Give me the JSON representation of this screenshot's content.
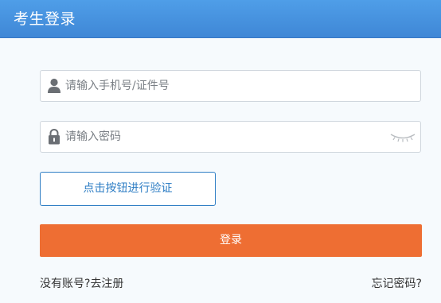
{
  "header": {
    "title": "考生登录"
  },
  "form": {
    "phone_placeholder": "请输入手机号/证件号",
    "password_placeholder": "请输入密码",
    "verify_label": "点击按钮进行验证",
    "login_label": "登录"
  },
  "footer": {
    "no_account_text": "没有账号?",
    "register_label": "去注册",
    "forgot_label": "忘记密码?"
  },
  "icons": {
    "phone_field": "user-icon",
    "password_field": "lock-icon",
    "password_visibility": "eye-closed-icon"
  },
  "colors": {
    "header": "#4392de",
    "accent_blue": "#2d7dc4",
    "login_button": "#ee6e33"
  }
}
